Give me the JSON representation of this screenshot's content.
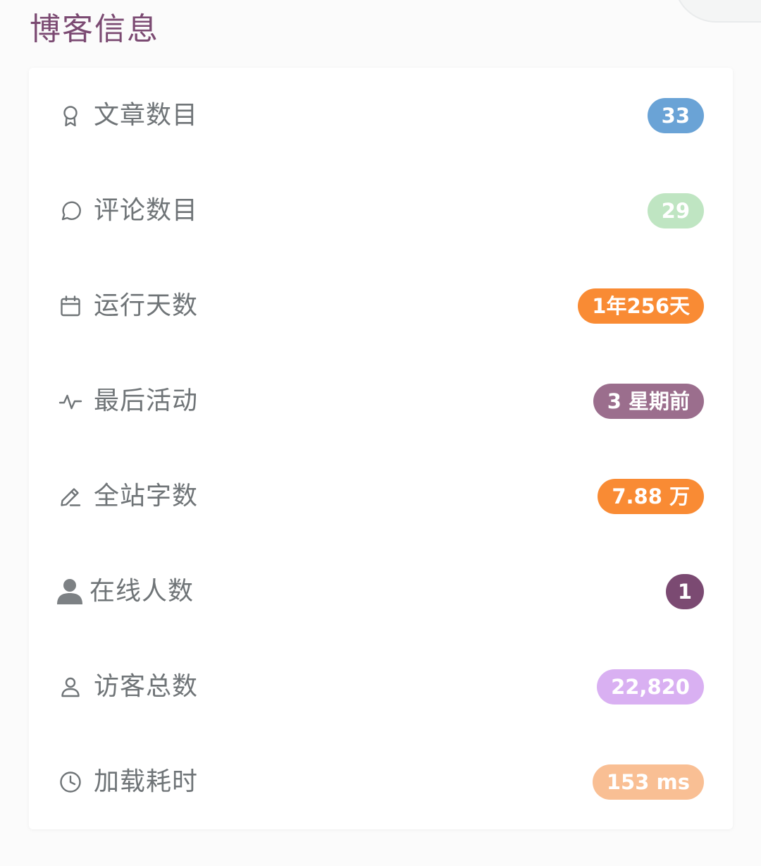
{
  "title": "博客信息",
  "stats": [
    {
      "label": "文章数目",
      "value": "33",
      "icon": "award-icon",
      "color": "#6aa3d6"
    },
    {
      "label": "评论数目",
      "value": "29",
      "icon": "comment-icon",
      "color": "#bfe5c2"
    },
    {
      "label": "运行天数",
      "value": "1年256天",
      "icon": "calendar-icon",
      "color": "#f98b34"
    },
    {
      "label": "最后活动",
      "value": "3 星期前",
      "icon": "activity-icon",
      "color": "#9b6e8d"
    },
    {
      "label": "全站字数",
      "value": "7.88 万",
      "icon": "pencil-icon",
      "color": "#f98b34"
    },
    {
      "label": "在线人数",
      "value": "1",
      "icon": "user-solid-icon",
      "color": "#7b4a72"
    },
    {
      "label": "访客总数",
      "value": "22,820",
      "icon": "user-icon",
      "color": "#d9b0f2"
    },
    {
      "label": "加载耗时",
      "value": "153 ms",
      "icon": "clock-icon",
      "color": "#f9bf94"
    }
  ]
}
